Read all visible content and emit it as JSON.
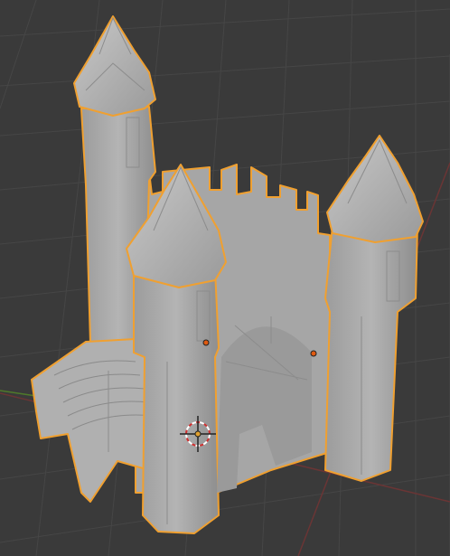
{
  "viewport": {
    "background": "#3a3a3a",
    "grid_color": "#454545",
    "x_axis_color": "#7a3a3a",
    "y_axis_color": "#5a7a2a",
    "selection_outline": "#f0a030",
    "mesh_color": "#a8a8a8"
  },
  "scene": {
    "object": "castle-model",
    "selected": true,
    "icons": [
      "3d-cursor-icon",
      "vertex-dot-icon"
    ]
  }
}
